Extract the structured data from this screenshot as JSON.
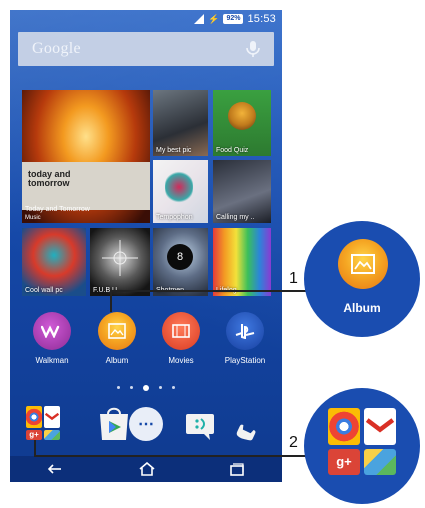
{
  "status_bar": {
    "battery": "92%",
    "time": "15:53"
  },
  "search": {
    "label": "Google"
  },
  "widgets": {
    "big_title": "today and\ntomorrow",
    "big_caption": "Today and Tomorrow",
    "big_sub": "Music",
    "my_best_pic": "My best pic",
    "food_quiz": "Food Quiz",
    "tempophon": "Tempophon",
    "calling_my": "Calling my ..",
    "cool_wall": "Cool wall pc",
    "fub": "F.U.B.U...",
    "shotmen": "Shotmen",
    "lifelog": "Lifelog"
  },
  "apps": [
    {
      "name": "Walkman",
      "color": "#a03aa8"
    },
    {
      "name": "Album",
      "color": "#f5a623"
    },
    {
      "name": "Movies",
      "color": "#e0452e"
    },
    {
      "name": "PlayStation",
      "color": "#1f4fb8"
    }
  ],
  "callouts": {
    "one": "1",
    "two": "2",
    "album_label": "Album"
  },
  "colors": {
    "home_bg": "#1548a8",
    "bubble_bg": "#1a4db0"
  }
}
